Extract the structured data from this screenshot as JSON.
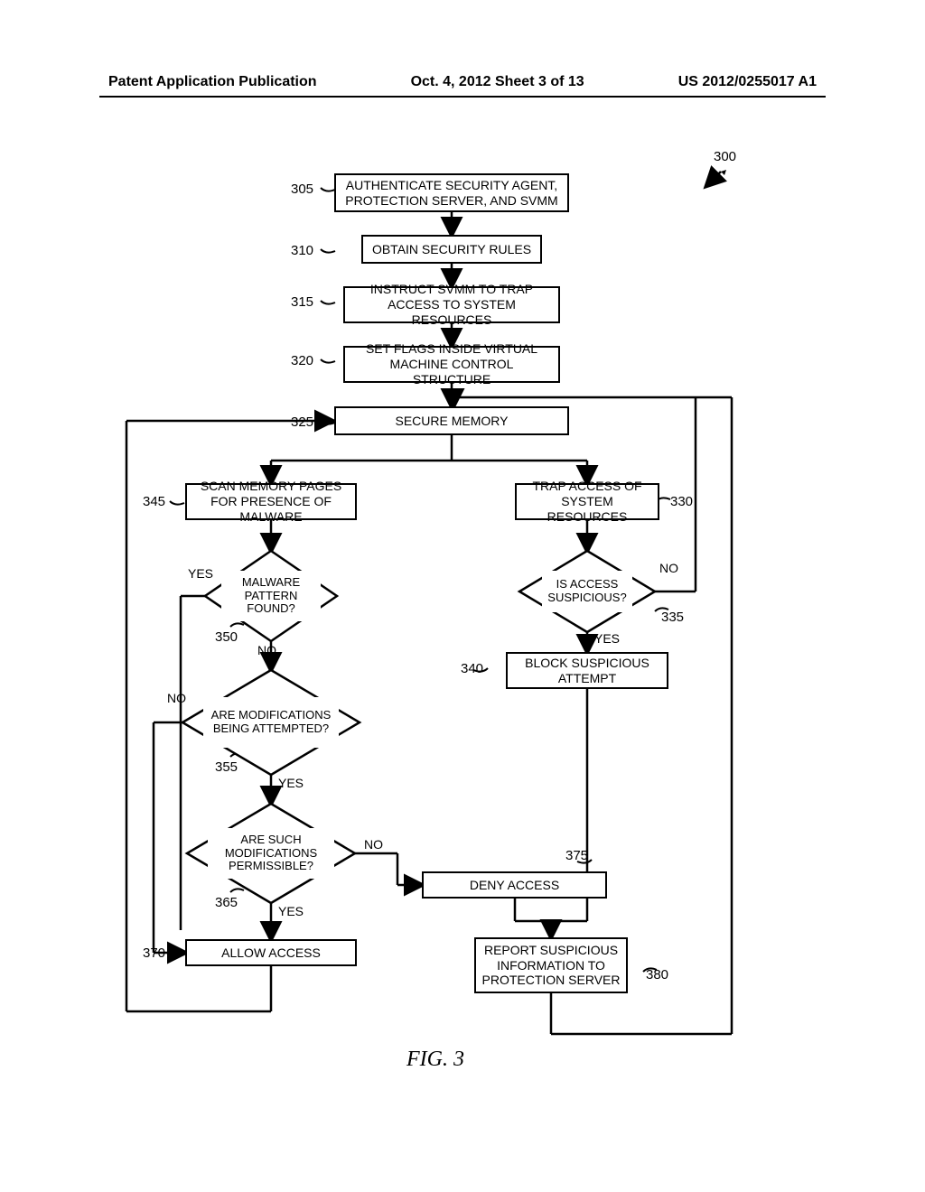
{
  "header": {
    "left": "Patent Application Publication",
    "center": "Oct. 4, 2012  Sheet 3 of 13",
    "right": "US 2012/0255017 A1"
  },
  "refs": {
    "r300": "300",
    "r305": "305",
    "r310": "310",
    "r315": "315",
    "r320": "320",
    "r325": "325",
    "r330": "330",
    "r340": "340",
    "r335": "335",
    "r345": "345",
    "r350": "350",
    "r355": "355",
    "r365": "365",
    "r370": "370",
    "r375": "375",
    "r380": "380"
  },
  "boxes": {
    "b305": "AUTHENTICATE SECURITY AGENT, PROTECTION SERVER, AND SVMM",
    "b310": "OBTAIN SECURITY RULES",
    "b315": "INSTRUCT SVMM TO TRAP ACCESS TO SYSTEM RESOURCES",
    "b320": "SET FLAGS INSIDE VIRTUAL MACHINE CONTROL STRUCTURE",
    "b325": "SECURE MEMORY",
    "b330": "TRAP ACCESS OF SYSTEM RESOURCES",
    "b340": "BLOCK SUSPICIOUS ATTEMPT",
    "b345": "SCAN MEMORY PAGES FOR PRESENCE OF MALWARE",
    "b370": "ALLOW ACCESS",
    "b375": "DENY ACCESS",
    "b380": "REPORT SUSPICIOUS INFORMATION TO PROTECTION SERVER"
  },
  "diamonds": {
    "d335": "IS ACCESS SUSPICIOUS?",
    "d350": "MALWARE PATTERN FOUND?",
    "d355": "ARE MODIFICATIONS BEING ATTEMPTED?",
    "d365": "ARE SUCH MODIFICATIONS PERMISSIBLE?"
  },
  "labels": {
    "yes": "YES",
    "no": "NO"
  },
  "caption": "FIG. 3",
  "chart_data": {
    "type": "flowchart",
    "title": "FIG. 3",
    "reference": "300",
    "nodes": [
      {
        "id": "305",
        "type": "process",
        "text": "AUTHENTICATE SECURITY AGENT, PROTECTION SERVER, AND SVMM"
      },
      {
        "id": "310",
        "type": "process",
        "text": "OBTAIN SECURITY RULES"
      },
      {
        "id": "315",
        "type": "process",
        "text": "INSTRUCT SVMM TO TRAP ACCESS TO SYSTEM RESOURCES"
      },
      {
        "id": "320",
        "type": "process",
        "text": "SET FLAGS INSIDE VIRTUAL MACHINE CONTROL STRUCTURE"
      },
      {
        "id": "325",
        "type": "process",
        "text": "SECURE MEMORY"
      },
      {
        "id": "330",
        "type": "process",
        "text": "TRAP ACCESS OF SYSTEM RESOURCES"
      },
      {
        "id": "335",
        "type": "decision",
        "text": "IS ACCESS SUSPICIOUS?"
      },
      {
        "id": "340",
        "type": "process",
        "text": "BLOCK SUSPICIOUS ATTEMPT"
      },
      {
        "id": "345",
        "type": "process",
        "text": "SCAN MEMORY PAGES FOR PRESENCE OF MALWARE"
      },
      {
        "id": "350",
        "type": "decision",
        "text": "MALWARE PATTERN FOUND?"
      },
      {
        "id": "355",
        "type": "decision",
        "text": "ARE MODIFICATIONS BEING ATTEMPTED?"
      },
      {
        "id": "365",
        "type": "decision",
        "text": "ARE SUCH MODIFICATIONS PERMISSIBLE?"
      },
      {
        "id": "370",
        "type": "process",
        "text": "ALLOW ACCESS"
      },
      {
        "id": "375",
        "type": "process",
        "text": "DENY ACCESS"
      },
      {
        "id": "380",
        "type": "process",
        "text": "REPORT SUSPICIOUS INFORMATION TO PROTECTION SERVER"
      }
    ],
    "edges": [
      {
        "from": "305",
        "to": "310"
      },
      {
        "from": "310",
        "to": "315"
      },
      {
        "from": "315",
        "to": "320"
      },
      {
        "from": "320",
        "to": "325"
      },
      {
        "from": "325",
        "to": "345"
      },
      {
        "from": "325",
        "to": "330"
      },
      {
        "from": "330",
        "to": "335"
      },
      {
        "from": "335",
        "to": "340",
        "label": "YES"
      },
      {
        "from": "335",
        "to": "325",
        "label": "NO"
      },
      {
        "from": "340",
        "to": "380"
      },
      {
        "from": "345",
        "to": "350"
      },
      {
        "from": "350",
        "to": "375",
        "label": "YES"
      },
      {
        "from": "350",
        "to": "355",
        "label": "NO"
      },
      {
        "from": "355",
        "to": "370",
        "label": "NO"
      },
      {
        "from": "355",
        "to": "365",
        "label": "YES"
      },
      {
        "from": "365",
        "to": "370",
        "label": "YES"
      },
      {
        "from": "365",
        "to": "375",
        "label": "NO"
      },
      {
        "from": "375",
        "to": "380"
      },
      {
        "from": "370",
        "to": "325"
      },
      {
        "from": "380",
        "to": "325"
      }
    ]
  }
}
